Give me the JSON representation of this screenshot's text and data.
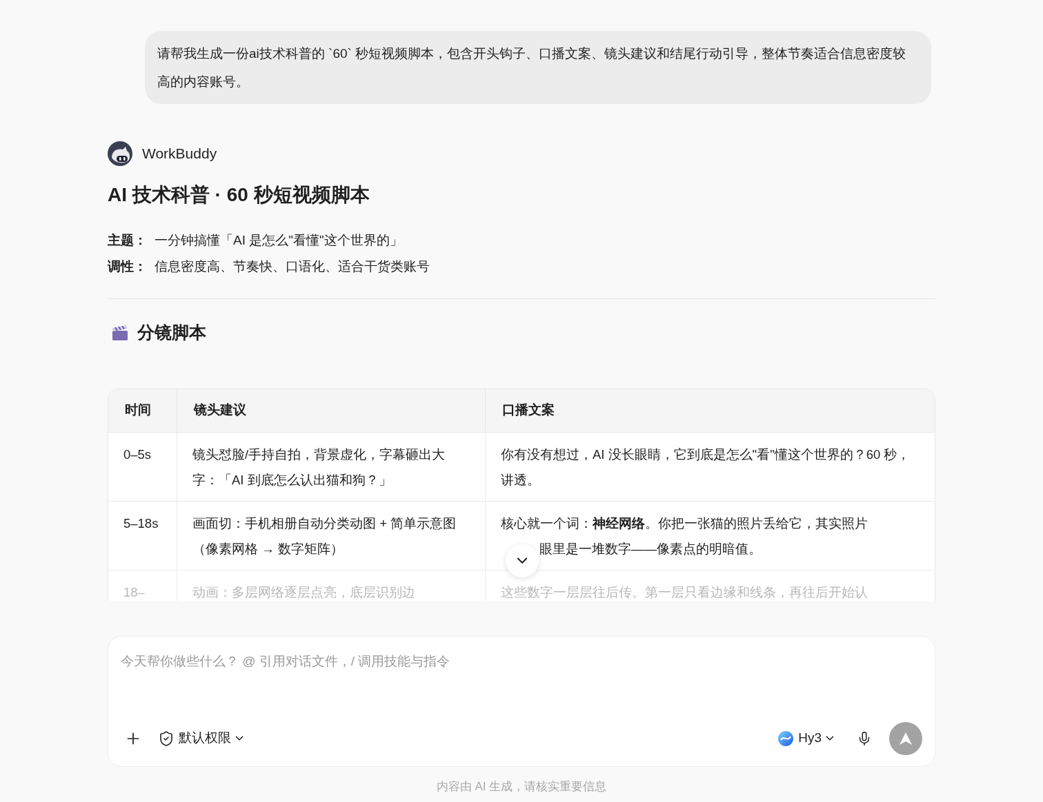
{
  "user_message": "请帮我生成一份ai技术科普的 `60` 秒短视频脚本，包含开头钩子、口播文案、镜头建议和结尾行动引导，整体节奏适合信息密度较高的内容账号。",
  "assistant": {
    "name": "WorkBuddy"
  },
  "title": "AI 技术科普 · 60 秒短视频脚本",
  "meta": [
    {
      "label": "主题：",
      "value": "一分钟搞懂「AI 是怎么\"看懂\"这个世界的」"
    },
    {
      "label": "调性：",
      "value": "信息密度高、节奏快、口语化、适合干货类账号"
    }
  ],
  "section_heading": "分镜脚本",
  "table": {
    "columns": [
      "时间",
      "镜头建议",
      "口播文案"
    ],
    "rows": [
      {
        "cells": [
          "0–5s",
          "镜头怼脸/手持自拍，背景虚化，字幕砸出大字：「AI 到底怎么认出猫和狗？」",
          "你有没有想过，AI 没长眼睛，它到底是怎么\"看\"懂这个世界的？60 秒，讲透。"
        ]
      },
      {
        "cells": [
          "5–18s",
          "画面切：手机相册自动分类动图 + 简单示意图（像素网格 → 数字矩阵）",
          [
            "核心就一个词：**神经网络**。你把一张猫的照片丢给它，其实照片",
            "眼里是一堆数字——像素点的明暗值。"
          ]
        ]
      },
      {
        "cells": [
          "18–",
          "动画：多层网络逐层点亮，底层识别边",
          "这些数字一层层往后传。第一层只看边缘和线条，再往后开始认"
        ]
      }
    ]
  },
  "composer": {
    "placeholder": "今天帮你做些什么？ @ 引用对话文件，/ 调用技能与指令",
    "permission": "默认权限",
    "model": "Hy3"
  },
  "disclaimer": "内容由 AI 生成，请核实重要信息"
}
